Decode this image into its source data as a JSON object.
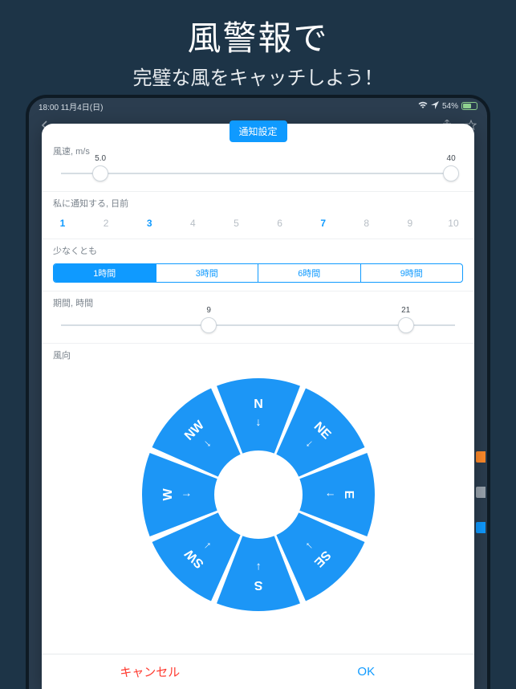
{
  "promo": {
    "title": "風警報で",
    "subtitle": "完璧な風をキャッチしよう！"
  },
  "status_bar": {
    "time_date": "18:00  11月4日(日)",
    "battery": "54%"
  },
  "modal": {
    "title": "通知設定",
    "wind_speed": {
      "label": "風速, m/s",
      "min_value": "5.0",
      "max_value": "40",
      "min_pos_pct": 10,
      "max_pos_pct": 99
    },
    "notify_days": {
      "label": "私に通知する, 日前",
      "items": [
        {
          "n": "1",
          "active": true
        },
        {
          "n": "2",
          "active": false
        },
        {
          "n": "3",
          "active": true
        },
        {
          "n": "4",
          "active": false
        },
        {
          "n": "5",
          "active": false
        },
        {
          "n": "6",
          "active": false
        },
        {
          "n": "7",
          "active": true
        },
        {
          "n": "8",
          "active": false
        },
        {
          "n": "9",
          "active": false
        },
        {
          "n": "10",
          "active": false
        }
      ]
    },
    "at_least": {
      "label": "少なくとも",
      "options": [
        {
          "label": "1時間",
          "selected": true
        },
        {
          "label": "3時間",
          "selected": false
        },
        {
          "label": "6時間",
          "selected": false
        },
        {
          "label": "9時間",
          "selected": false
        }
      ]
    },
    "period": {
      "label": "期間, 時間",
      "min_value": "9",
      "max_value": "21",
      "min_pos_pct": 37.5,
      "max_pos_pct": 87.5
    },
    "direction": {
      "label": "風向",
      "points": [
        "N",
        "NE",
        "E",
        "SE",
        "S",
        "SW",
        "W",
        "NW"
      ]
    },
    "cancel_label": "キャンセル",
    "ok_label": "OK"
  },
  "icons": {
    "back": "back-arrow-icon",
    "share": "share-icon",
    "star": "star-icon",
    "wifi": "wifi-icon",
    "location": "location-icon"
  },
  "colors": {
    "accent": "#0f9aff",
    "bg": "#1d3447",
    "danger": "#ff3b30"
  }
}
